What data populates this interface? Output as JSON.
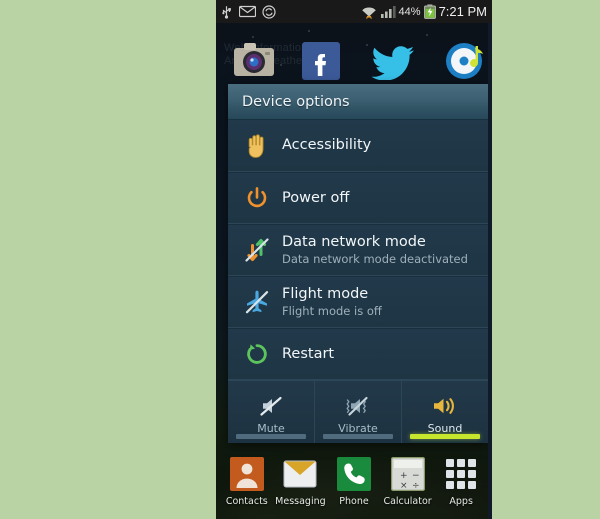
{
  "statusbar": {
    "left_icons": [
      "usb-icon",
      "email-icon",
      "sync-icon"
    ],
    "wifi_icon": "wifi-icon",
    "signal_icon": "signal-bars-icon",
    "battery_percent": "44%",
    "battery_icon": "battery-charging-icon",
    "time": "7:21 PM"
  },
  "wallpaper": {
    "watermark_line1": "Web Informationz.com",
    "watermark_line2": "AndroidWeather.com"
  },
  "top_apps": [
    {
      "name": "camera-app-icon",
      "label": "Camera"
    },
    {
      "name": "facebook-app-icon",
      "label": "Facebook"
    },
    {
      "name": "twitter-app-icon",
      "label": "Twitter"
    },
    {
      "name": "music-player-app-icon",
      "label": "Music Player"
    }
  ],
  "dialog": {
    "title": "Device options",
    "options": [
      {
        "icon": "accessibility-hand-icon",
        "title": "Accessibility",
        "subtitle": "",
        "accent": "#f0c060"
      },
      {
        "icon": "power-off-icon",
        "title": "Power off",
        "subtitle": "",
        "accent": "#f0922b"
      },
      {
        "icon": "data-network-mode-icon",
        "title": "Data network mode",
        "subtitle": "Data network mode deactivated",
        "accent": "#4ec16a"
      },
      {
        "icon": "flight-mode-icon",
        "title": "Flight mode",
        "subtitle": "Flight mode is off",
        "accent": "#49a8e0"
      },
      {
        "icon": "restart-icon",
        "title": "Restart",
        "subtitle": "",
        "accent": "#5dc45d"
      }
    ],
    "sound_modes": [
      {
        "icon": "mute-icon",
        "label": "Mute",
        "selected": false
      },
      {
        "icon": "vibrate-icon",
        "label": "Vibrate",
        "selected": false
      },
      {
        "icon": "sound-icon",
        "label": "Sound",
        "selected": true
      }
    ],
    "selected_underline_color": "#c6e72d"
  },
  "dock": [
    {
      "icon": "contacts-icon",
      "label": "Contacts"
    },
    {
      "icon": "messaging-icon",
      "label": "Messaging"
    },
    {
      "icon": "phone-icon",
      "label": "Phone"
    },
    {
      "icon": "calculator-icon",
      "label": "Calculator"
    },
    {
      "icon": "apps-grid-icon",
      "label": "Apps"
    }
  ],
  "colors": {
    "page_background": "#b9d3a5",
    "dialog_body": "#20394a",
    "dialog_title_bar": "#3c5f71",
    "accent_selected": "#c6e72d"
  }
}
